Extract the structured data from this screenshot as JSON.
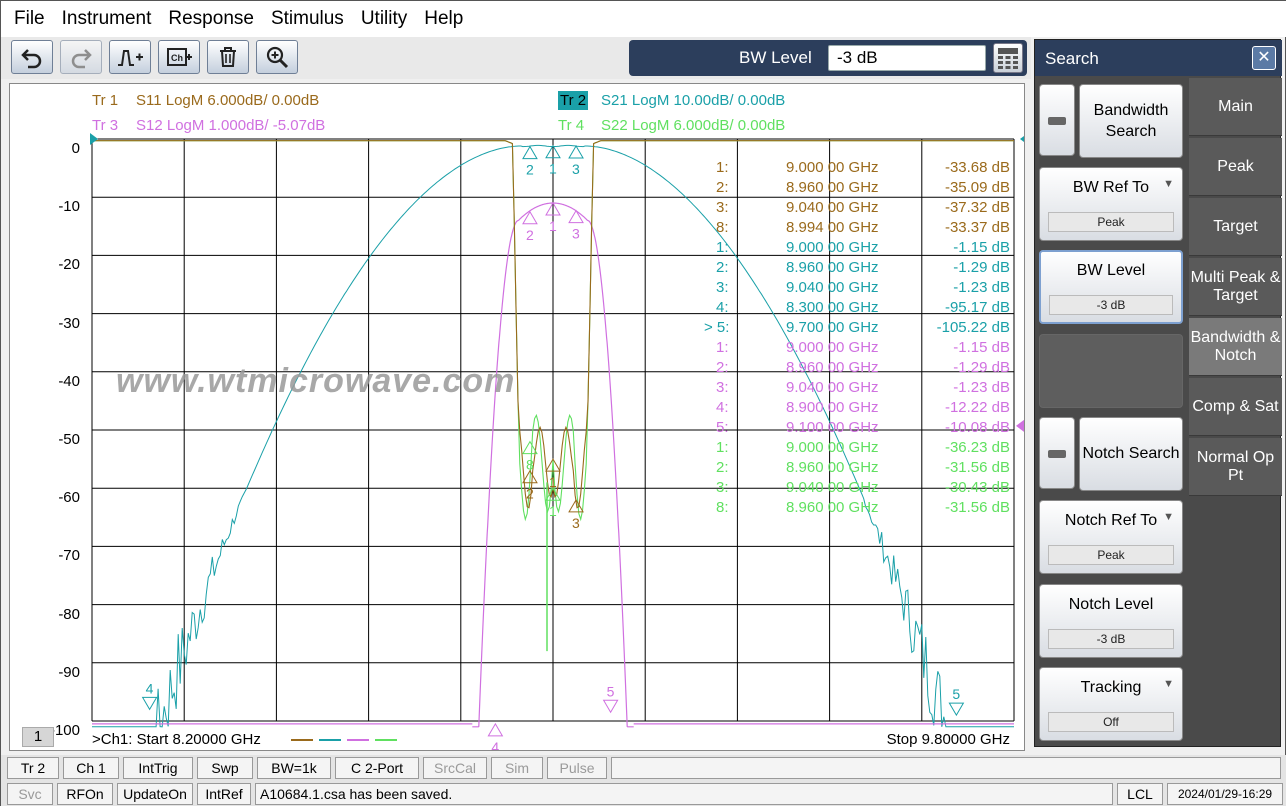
{
  "menu": [
    "File",
    "Instrument",
    "Response",
    "Stimulus",
    "Utility",
    "Help"
  ],
  "toolbar": {
    "icons": [
      "undo-icon",
      "redo-icon",
      "marker-add-icon",
      "channel-add-icon",
      "trash-icon",
      "zoom-icon"
    ],
    "bw_level_label": "BW Level",
    "bw_level_value": "-3 dB"
  },
  "traces": [
    {
      "label": "Tr  1",
      "desc": "S11 LogM 6.000dB/  0.00dB",
      "color": "#9a6a1c"
    },
    {
      "label": "Tr  2",
      "desc": "S21 LogM 10.00dB/  0.00dB",
      "color": "#1aa0a8"
    },
    {
      "label": "Tr  3",
      "desc": "S12 LogM 1.000dB/  -5.07dB",
      "color": "#d070e0"
    },
    {
      "label": "Tr  4",
      "desc": "S22 LogM 6.000dB/  0.00dB",
      "color": "#60e060"
    }
  ],
  "y_axis": [
    "0",
    "-10",
    "-20",
    "-30",
    "-40",
    "-50",
    "-60",
    "-70",
    "-80",
    "-90",
    "-100"
  ],
  "markers": [
    {
      "id": "1:",
      "freq": "9.000 00 GHz",
      "val": "-33.68 dB",
      "color": "#9a6a1c"
    },
    {
      "id": "2:",
      "freq": "8.960 00 GHz",
      "val": "-35.09 dB",
      "color": "#9a6a1c"
    },
    {
      "id": "3:",
      "freq": "9.040 00 GHz",
      "val": "-37.32 dB",
      "color": "#9a6a1c"
    },
    {
      "id": "8:",
      "freq": "8.994 00 GHz",
      "val": "-33.37 dB",
      "color": "#9a6a1c"
    },
    {
      "id": "1:",
      "freq": "9.000 00 GHz",
      "val": "-1.15 dB",
      "color": "#1aa0a8"
    },
    {
      "id": "2:",
      "freq": "8.960 00 GHz",
      "val": "-1.29 dB",
      "color": "#1aa0a8"
    },
    {
      "id": "3:",
      "freq": "9.040 00 GHz",
      "val": "-1.23 dB",
      "color": "#1aa0a8"
    },
    {
      "id": "4:",
      "freq": "8.300 00 GHz",
      "val": "-95.17 dB",
      "color": "#1aa0a8"
    },
    {
      "id": "> 5:",
      "freq": "9.700 00 GHz",
      "val": "-105.22 dB",
      "color": "#1aa0a8"
    },
    {
      "id": "1:",
      "freq": "9.000 00 GHz",
      "val": "-1.15 dB",
      "color": "#d070e0"
    },
    {
      "id": "2:",
      "freq": "8.960 00 GHz",
      "val": "-1.29 dB",
      "color": "#d070e0"
    },
    {
      "id": "3:",
      "freq": "9.040 00 GHz",
      "val": "-1.23 dB",
      "color": "#d070e0"
    },
    {
      "id": "4:",
      "freq": "8.900 00 GHz",
      "val": "-12.22 dB",
      "color": "#d070e0"
    },
    {
      "id": "5:",
      "freq": "9.100 00 GHz",
      "val": "-10.08 dB",
      "color": "#d070e0"
    },
    {
      "id": "1:",
      "freq": "9.000 00 GHz",
      "val": "-36.23 dB",
      "color": "#60e060"
    },
    {
      "id": "2:",
      "freq": "8.960 00 GHz",
      "val": "-31.56 dB",
      "color": "#60e060"
    },
    {
      "id": "3:",
      "freq": "9.040 00 GHz",
      "val": "-30.43 dB",
      "color": "#60e060"
    },
    {
      "id": "8:",
      "freq": "8.960 00 GHz",
      "val": "-31.56 dB",
      "color": "#60e060"
    }
  ],
  "watermark": "www.wtmicrowave.com",
  "channel": {
    "num": "1",
    "start": ">Ch1:  Start   8.20000 GHz",
    "stop": "Stop  9.80000 GHz"
  },
  "panel": {
    "title": "Search",
    "close": "✕",
    "softkeys": {
      "bandwidth_search": "Bandwidth Search",
      "bw_ref_to": "BW Ref To",
      "bw_ref_to_value": "Peak",
      "bw_level": "BW Level",
      "bw_level_value": "-3 dB",
      "notch_search": "Notch Search",
      "notch_ref_to": "Notch Ref To",
      "notch_ref_to_value": "Peak",
      "notch_level": "Notch Level",
      "notch_level_value": "-3 dB",
      "tracking": "Tracking",
      "tracking_value": "Off"
    },
    "tabs": [
      "Main",
      "Peak",
      "Target",
      "Multi Peak & Target",
      "Bandwidth & Notch",
      "Comp & Sat",
      "Normal Op Pt"
    ]
  },
  "status1": [
    "Tr 2",
    "Ch 1",
    "IntTrig",
    "Swp",
    "BW=1k",
    "C  2-Port",
    "SrcCal",
    "Sim",
    "Pulse"
  ],
  "status2": {
    "items": [
      "Svc",
      "RFOn",
      "UpdateOn",
      "IntRef"
    ],
    "message": "A10684.1.csa has been saved.",
    "lcl": "LCL",
    "datetime": "2024/01/29-16:29"
  }
}
